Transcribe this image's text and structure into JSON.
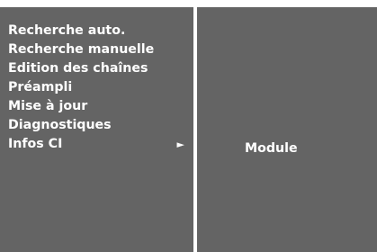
{
  "menu": {
    "items": [
      {
        "label": "Recherche auto."
      },
      {
        "label": "Recherche manuelle"
      },
      {
        "label": "Edition des chaînes"
      },
      {
        "label": "Préampli"
      },
      {
        "label": "Mise à jour"
      },
      {
        "label": "Diagnostiques"
      },
      {
        "label": "Infos CI",
        "arrow": "►",
        "selected": true
      }
    ]
  },
  "submenu": {
    "items": [
      {
        "label": "Module"
      }
    ]
  },
  "colors": {
    "panel": "#646464",
    "divider": "#ffffff",
    "text": "#ffffff"
  },
  "icons": {
    "submenu_arrow": "right-triangle-icon"
  }
}
